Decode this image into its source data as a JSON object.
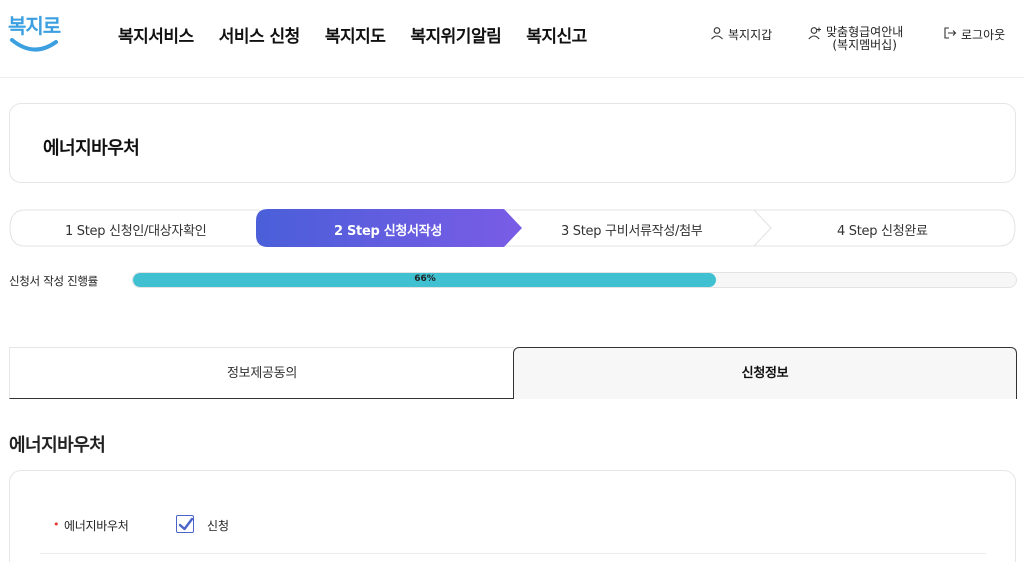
{
  "header": {
    "logo_text": "복지로",
    "nav": [
      "복지서비스",
      "서비스 신청",
      "복지지도",
      "복지위기알림",
      "복지신고"
    ],
    "util": {
      "wallet": "복지지갑",
      "member_line1": "맞춤형급여안내",
      "member_line2": "(복지멤버십)",
      "logout": "로그아웃"
    }
  },
  "page_title": "에너지바우처",
  "steps": [
    {
      "label": "1 Step 신청인/대상자확인",
      "active": false
    },
    {
      "label": "2 Step 신청서작성",
      "active": true
    },
    {
      "label": "3 Step 구비서류작성/첨부",
      "active": false
    },
    {
      "label": "4 Step 신청완료",
      "active": false
    }
  ],
  "progress": {
    "label": "신청서 작성 진행률",
    "value": 0.66,
    "text": "66%"
  },
  "tabs": [
    {
      "label": "정보제공동의",
      "active": false
    },
    {
      "label": "신청정보",
      "active": true
    }
  ],
  "section_title": "에너지바우처",
  "form": {
    "field_label": "에너지바우처",
    "checkbox_label": "신청",
    "checked": true
  },
  "colors": {
    "brand": "#3b9fe0",
    "step_active_start": "#4a5fd9",
    "step_active_end": "#7a5ce6",
    "progress": "#3fc1d1",
    "required": "#e53935"
  }
}
